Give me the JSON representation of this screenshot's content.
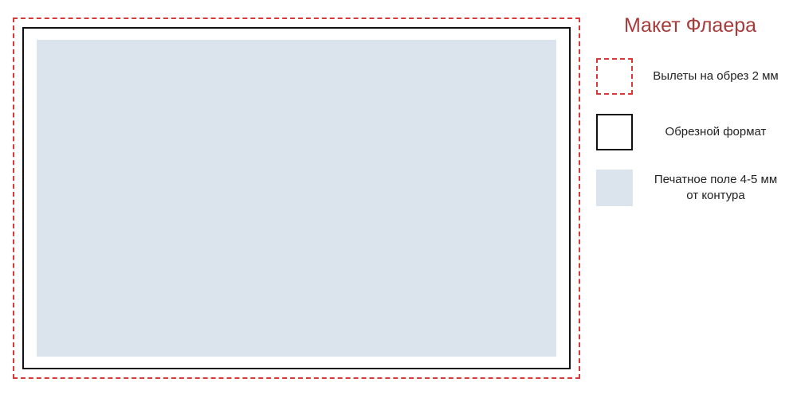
{
  "title": "Макет Флаера",
  "legend": {
    "bleed": "Вылеты на обрез 2 мм",
    "trim": "Обрезной формат",
    "safe": "Печатное поле 4-5 мм от контура"
  },
  "colors": {
    "bleed_border": "#d83a3a",
    "trim_border": "#111111",
    "safe_fill": "#dbe4ec",
    "title_color": "#a73a3a"
  }
}
